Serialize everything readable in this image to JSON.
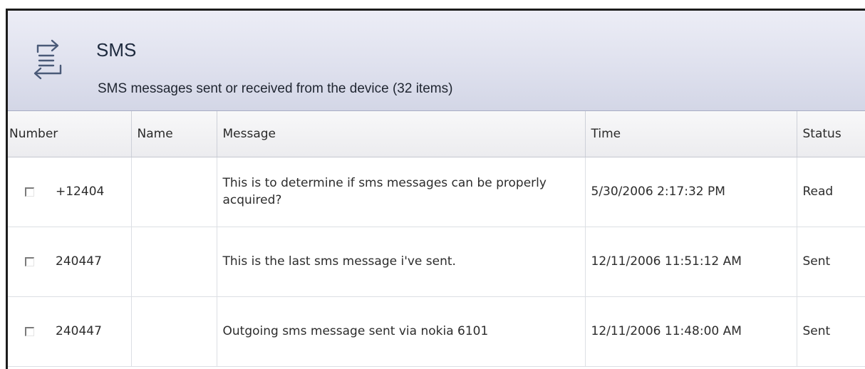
{
  "header": {
    "title": "SMS",
    "subtitle": "SMS messages sent or received from the device (32 items)",
    "icon": "transfer-arrows-icon"
  },
  "columns": {
    "number": "Number",
    "name": "Name",
    "message": "Message",
    "time": "Time",
    "status": "Status"
  },
  "rows": [
    {
      "number": "+12404",
      "name": "",
      "message": "This is to determine if sms messages can be properly acquired?",
      "time": "5/30/2006 2:17:32 PM",
      "status": "Read",
      "checked": false
    },
    {
      "number": "240447",
      "name": "",
      "message": "This is the last sms message i've sent.",
      "time": "12/11/2006 11:51:12 AM",
      "status": "Sent",
      "checked": false
    },
    {
      "number": "240447",
      "name": "",
      "message": "Outgoing sms message sent via nokia 6101",
      "time": "12/11/2006 11:48:00 AM",
      "status": "Sent",
      "checked": false
    }
  ],
  "colors": {
    "header_top": "#ecedf6",
    "header_bottom": "#d3d6e6",
    "icon": "#4a5a78"
  }
}
